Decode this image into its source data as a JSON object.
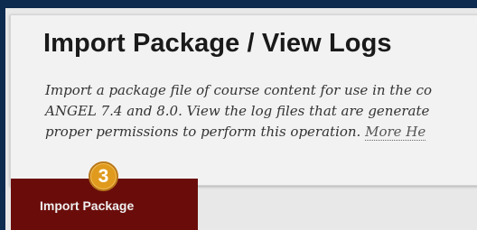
{
  "header": {
    "title": "Import Package / View Logs",
    "description_lines": [
      "Import a package file of course content for use in the co",
      "ANGEL 7.4 and 8.0. View the log files that are generate",
      "proper permissions to perform this operation. "
    ],
    "more_help": "More He"
  },
  "actions": {
    "import_package_label": "Import Package",
    "step_badge": "3"
  },
  "colors": {
    "frame": "#0d2a4f",
    "button": "#6a0d0a",
    "badge": "#e09a1e"
  }
}
